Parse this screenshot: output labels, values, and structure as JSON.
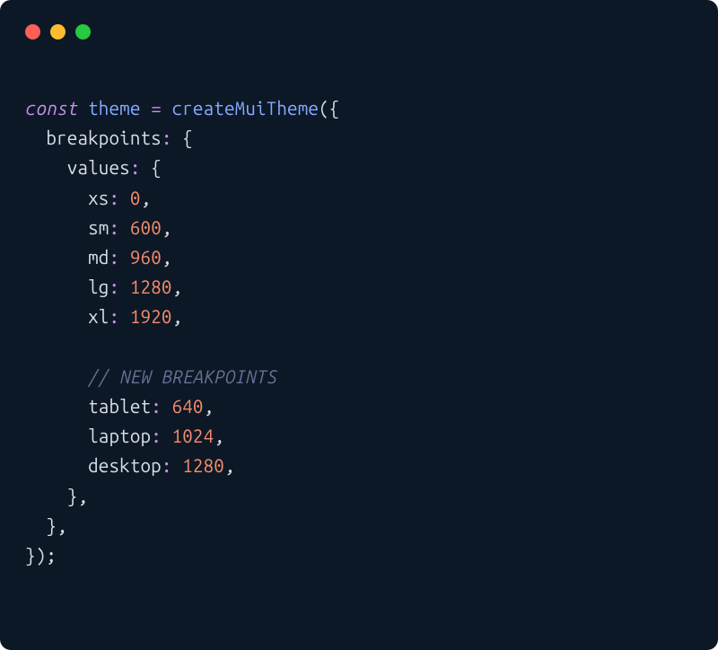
{
  "code": {
    "keyword_const": "const",
    "var_name": "theme",
    "equals": "=",
    "func_name": "createMuiTheme",
    "open_paren": "(",
    "open_brace": "{",
    "close_brace": "}",
    "close_paren": ")",
    "semicolon": ";",
    "colon": ":",
    "comma": ",",
    "prop_breakpoints": "breakpoints",
    "prop_values": "values",
    "prop_xs": "xs",
    "val_xs": "0",
    "prop_sm": "sm",
    "val_sm": "600",
    "prop_md": "md",
    "val_md": "960",
    "prop_lg": "lg",
    "val_lg": "1280",
    "prop_xl": "xl",
    "val_xl": "1920",
    "comment_new": "// NEW BREAKPOINTS",
    "prop_tablet": "tablet",
    "val_tablet": "640",
    "prop_laptop": "laptop",
    "val_laptop": "1024",
    "prop_desktop": "desktop",
    "val_desktop": "1280"
  }
}
